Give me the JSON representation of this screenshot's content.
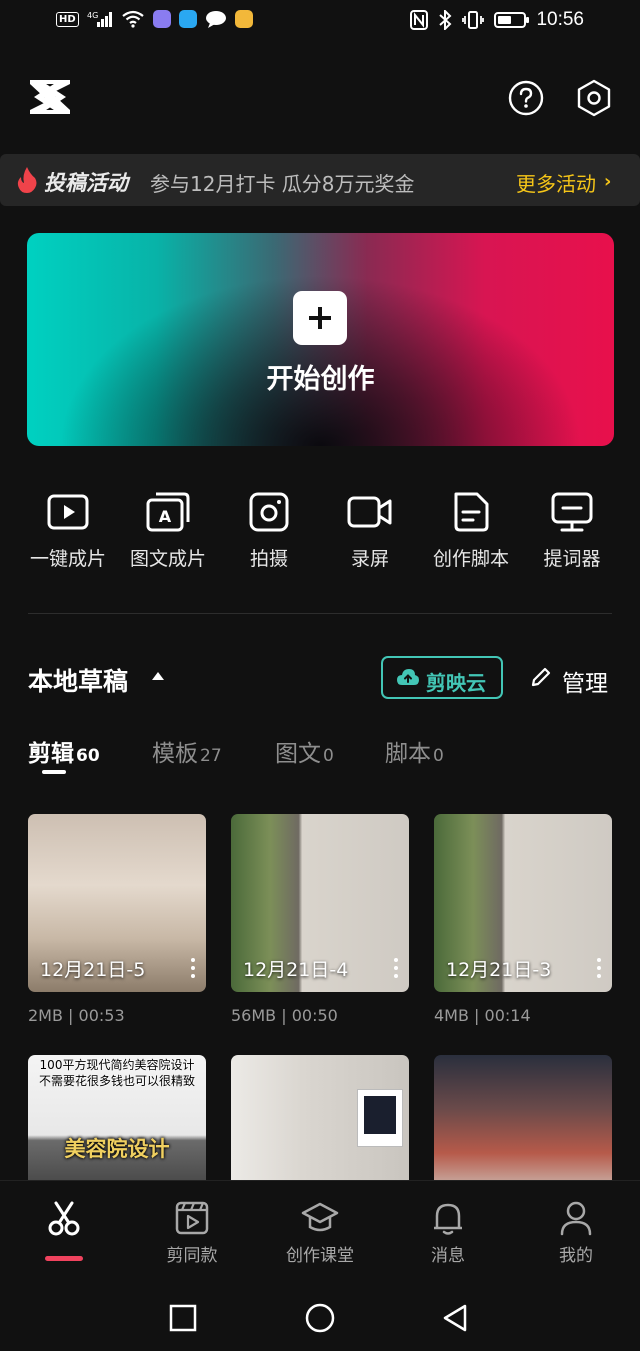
{
  "status_bar": {
    "time": "10:56",
    "network": "4G",
    "hd": "HD",
    "battery_level": 0.55
  },
  "header": {
    "logo_icon": "capcut-logo",
    "help_icon": "help-icon",
    "settings_icon": "settings-hex-icon"
  },
  "banner": {
    "title": "投稿活动",
    "description": "参与12月打卡 瓜分8万元奖金",
    "more_label": "更多活动",
    "more_chevron": "›",
    "accent_color": "#f5c518"
  },
  "create": {
    "label": "开始创作"
  },
  "tools": [
    {
      "label": "一键成片",
      "icon": "play-square-icon"
    },
    {
      "label": "图文成片",
      "icon": "text-image-icon"
    },
    {
      "label": "拍摄",
      "icon": "camera-icon"
    },
    {
      "label": "录屏",
      "icon": "video-record-icon"
    },
    {
      "label": "创作脚本",
      "icon": "script-doc-icon"
    },
    {
      "label": "提词器",
      "icon": "teleprompter-icon"
    }
  ],
  "drafts": {
    "title": "本地草稿",
    "cloud_label": "剪映云",
    "manage_label": "管理",
    "tabs": [
      {
        "name": "剪辑",
        "count": "60",
        "active": true
      },
      {
        "name": "模板",
        "count": "27",
        "active": false
      },
      {
        "name": "图文",
        "count": "0",
        "active": false
      },
      {
        "name": "脚本",
        "count": "0",
        "active": false
      }
    ],
    "items": [
      {
        "title": "12月21日-5",
        "size": "2MB",
        "duration": "00:53"
      },
      {
        "title": "12月21日-4",
        "size": "56MB",
        "duration": "00:50"
      },
      {
        "title": "12月21日-3",
        "size": "4MB",
        "duration": "00:14"
      }
    ],
    "partial_items": [
      {
        "overlay_line1": "100平方现代简约美容院设计",
        "overlay_line2": "不需要花很多钱也可以很精致",
        "overlay_big": "美容院设计"
      },
      {},
      {}
    ]
  },
  "bottom_nav": [
    {
      "label": "",
      "icon": "scissors-icon",
      "active": true
    },
    {
      "label": "剪同款",
      "icon": "template-icon",
      "active": false
    },
    {
      "label": "创作课堂",
      "icon": "graduation-cap-icon",
      "active": false
    },
    {
      "label": "消息",
      "icon": "bell-icon",
      "active": false
    },
    {
      "label": "我的",
      "icon": "profile-icon",
      "active": false
    }
  ],
  "colors": {
    "active_tab_indicator": "#f0435e",
    "cloud_accent": "#43c6b6",
    "background": "#111111"
  }
}
